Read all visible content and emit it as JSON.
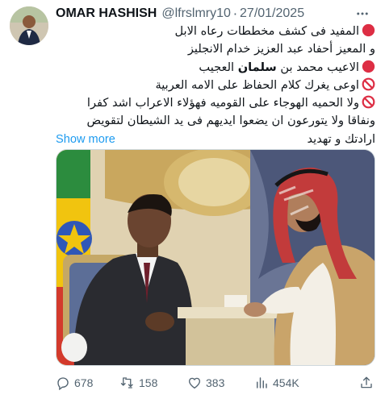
{
  "tweet": {
    "author": {
      "display_name": "OMAR HASHISH",
      "handle": "@lfrslmry10",
      "separator": "·",
      "date": "27/01/2025"
    },
    "more_icon": "more-horizontal-icon",
    "text": {
      "line1": "المفيد فى كشف مخططات رعاه الابل",
      "line2": "و المعيز أحفاد عبد العزيز خدام الانجليز",
      "line3_pre": "الاعيب محمد بن ",
      "line3_bold": "سلمان",
      "line3_post": " العجيب",
      "line4": "اوعى يغرك كلام الحفاظ على الامه العربية",
      "line5": "ولا الحميه الهوجاء على القوميه فهؤلاء الاعراب اشد كفرا",
      "line6": "ونفاقا ولا يتورعون ان يضعوا ايديهم فى يد الشيطان لتقويض",
      "line7_pre": "ارادتك و تهديد",
      "show_more": "Show more"
    },
    "emojis": {
      "red_circle": "red-circle-emoji",
      "no_entry": "prohibited-emoji",
      "red_circle_color": "#dd2e44"
    },
    "media": {
      "description_icon": "photo-two-men-meeting"
    },
    "actions": {
      "replies": "678",
      "retweets": "158",
      "likes": "383",
      "views": "454K"
    },
    "colors": {
      "accent": "#1d9bf0",
      "secondary_text": "#536471"
    }
  }
}
